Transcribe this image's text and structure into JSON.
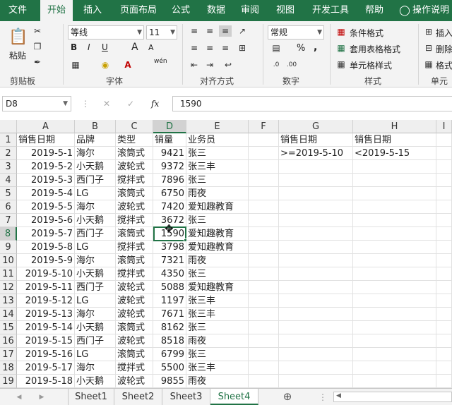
{
  "menu": {
    "tabs": [
      "文件",
      "开始",
      "插入",
      "页面布局",
      "公式",
      "数据",
      "审阅",
      "视图",
      "开发工具",
      "帮助"
    ],
    "active": "开始",
    "search_label": "操作说明"
  },
  "ribbon": {
    "clipboard": {
      "paste": "粘贴",
      "label": "剪贴板"
    },
    "font": {
      "name": "等线",
      "size": "11",
      "bold": "B",
      "italic": "I",
      "underline": "U",
      "grow": "A",
      "shrink": "A",
      "wen": "wén",
      "label": "字体"
    },
    "alignment": {
      "label": "对齐方式"
    },
    "number": {
      "format": "常规",
      "percent": "%",
      "comma": ",",
      "label": "数字"
    },
    "styles": {
      "conditional": "条件格式",
      "table": "套用表格格式",
      "cell": "单元格样式",
      "label": "样式"
    },
    "cells": {
      "insert": "插入",
      "delete": "删除",
      "format": "格式",
      "label": "单元格"
    }
  },
  "formula_bar": {
    "name_box": "D8",
    "fx": "fx",
    "value": "1590"
  },
  "columns": [
    "A",
    "B",
    "C",
    "D",
    "E",
    "F",
    "G",
    "H",
    "I"
  ],
  "selected_column": "D",
  "selected_row": 8,
  "rows": [
    {
      "n": 1,
      "A": "销售日期",
      "B": "品牌",
      "C": "类型",
      "D": "销量",
      "E": "业务员",
      "G": "销售日期",
      "H": "销售日期"
    },
    {
      "n": 2,
      "A": "2019-5-1",
      "B": "海尔",
      "C": "滚筒式",
      "D": "9421",
      "E": "张三",
      "G": ">=2019-5-10",
      "H": "<2019-5-15"
    },
    {
      "n": 3,
      "A": "2019-5-2",
      "B": "小天鹅",
      "C": "波轮式",
      "D": "9372",
      "E": "张三丰"
    },
    {
      "n": 4,
      "A": "2019-5-3",
      "B": "西门子",
      "C": "搅拌式",
      "D": "7896",
      "E": "张三"
    },
    {
      "n": 5,
      "A": "2019-5-4",
      "B": "LG",
      "C": "滚筒式",
      "D": "6750",
      "E": "雨夜"
    },
    {
      "n": 6,
      "A": "2019-5-5",
      "B": "海尔",
      "C": "波轮式",
      "D": "7420",
      "E": "爱知趣教育"
    },
    {
      "n": 7,
      "A": "2019-5-6",
      "B": "小天鹅",
      "C": "搅拌式",
      "D": "3672",
      "E": "张三"
    },
    {
      "n": 8,
      "A": "2019-5-7",
      "B": "西门子",
      "C": "滚筒式",
      "D": "1590",
      "E": "爱知趣教育"
    },
    {
      "n": 9,
      "A": "2019-5-8",
      "B": "LG",
      "C": "搅拌式",
      "D": "3798",
      "E": "爱知趣教育"
    },
    {
      "n": 10,
      "A": "2019-5-9",
      "B": "海尔",
      "C": "滚筒式",
      "D": "7321",
      "E": "雨夜"
    },
    {
      "n": 11,
      "A": "2019-5-10",
      "B": "小天鹅",
      "C": "搅拌式",
      "D": "4350",
      "E": "张三"
    },
    {
      "n": 12,
      "A": "2019-5-11",
      "B": "西门子",
      "C": "波轮式",
      "D": "5088",
      "E": "爱知趣教育"
    },
    {
      "n": 13,
      "A": "2019-5-12",
      "B": "LG",
      "C": "波轮式",
      "D": "1197",
      "E": "张三丰"
    },
    {
      "n": 14,
      "A": "2019-5-13",
      "B": "海尔",
      "C": "波轮式",
      "D": "7671",
      "E": "张三丰"
    },
    {
      "n": 15,
      "A": "2019-5-14",
      "B": "小天鹅",
      "C": "滚筒式",
      "D": "8162",
      "E": "张三"
    },
    {
      "n": 16,
      "A": "2019-5-15",
      "B": "西门子",
      "C": "波轮式",
      "D": "8518",
      "E": "雨夜"
    },
    {
      "n": 17,
      "A": "2019-5-16",
      "B": "LG",
      "C": "滚筒式",
      "D": "6799",
      "E": "张三"
    },
    {
      "n": 18,
      "A": "2019-5-17",
      "B": "海尔",
      "C": "搅拌式",
      "D": "5500",
      "E": "张三丰"
    },
    {
      "n": 19,
      "A": "2019-5-18",
      "B": "小天鹅",
      "C": "波轮式",
      "D": "9855",
      "E": "雨夜"
    }
  ],
  "sheets": [
    "Sheet1",
    "Sheet2",
    "Sheet3",
    "Sheet4"
  ],
  "active_sheet": "Sheet4",
  "colors": {
    "accent": "#217346"
  }
}
